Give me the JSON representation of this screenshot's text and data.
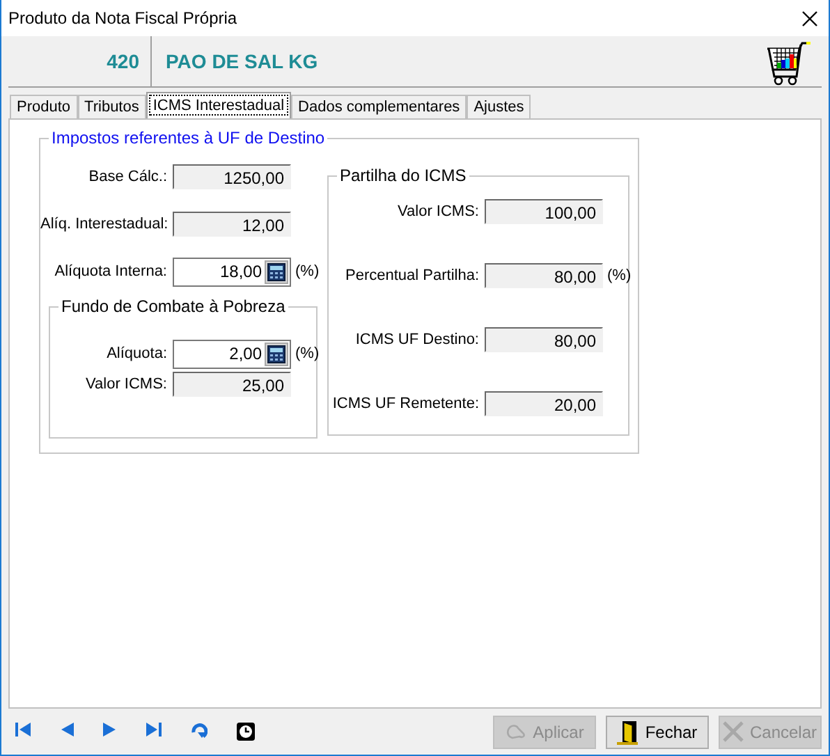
{
  "window": {
    "title": "Produto da Nota Fiscal Própria"
  },
  "product": {
    "code": "420",
    "name": "PAO DE SAL KG"
  },
  "tabs": [
    {
      "label": "Produto",
      "selected": false
    },
    {
      "label": "Tributos",
      "selected": false
    },
    {
      "label": "ICMS Interestadual",
      "selected": true
    },
    {
      "label": "Dados complementares",
      "selected": false
    },
    {
      "label": "Ajustes",
      "selected": false
    }
  ],
  "destination_group": {
    "title": "Impostos referentes à UF de Destino",
    "fields": [
      {
        "label": "Base Cálc.:",
        "value": "1250,00",
        "kind": "readonly"
      },
      {
        "label": "Alíq. Interestadual:",
        "value": "12,00",
        "kind": "readonly"
      },
      {
        "label": "Alíquota Interna:",
        "value": "18,00",
        "kind": "calc",
        "unit": "(%)"
      }
    ],
    "poverty_fund": {
      "title": "Fundo de Combate à Pobreza",
      "fields": [
        {
          "label": "Alíquota:",
          "value": "2,00",
          "kind": "calc",
          "unit": "(%)"
        },
        {
          "label": "Valor ICMS:",
          "value": "25,00",
          "kind": "readonly"
        }
      ]
    },
    "sharing": {
      "title": "Partilha do ICMS",
      "fields": [
        {
          "label": "Valor ICMS:",
          "value": "100,00",
          "kind": "readonly"
        },
        {
          "label": "Percentual Partilha:",
          "value": "80,00",
          "kind": "readonly",
          "unit": "(%)"
        },
        {
          "label": "ICMS UF Destino:",
          "value": "80,00",
          "kind": "readonly"
        },
        {
          "label": "ICMS UF Remetente:",
          "value": "20,00",
          "kind": "readonly"
        }
      ]
    }
  },
  "buttons": [
    {
      "label": "Aplicar",
      "kind": "apply",
      "disabled": true
    },
    {
      "label": "Fechar",
      "kind": "close",
      "disabled": false
    },
    {
      "label": "Cancelar",
      "kind": "cancel",
      "disabled": true
    }
  ]
}
